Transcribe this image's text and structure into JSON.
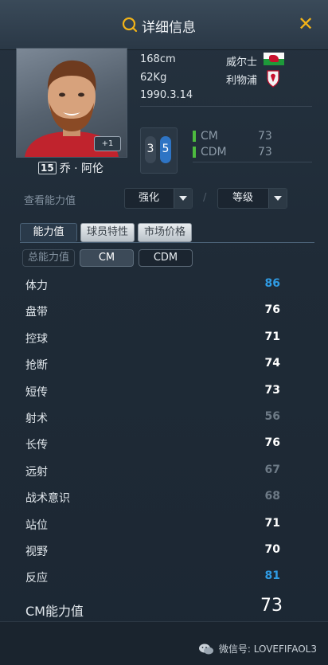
{
  "header": {
    "title": "详细信息"
  },
  "player": {
    "height": "168cm",
    "weight": "62Kg",
    "birthdate": "1990.3.14",
    "nation": "威尔士",
    "club": "利物浦",
    "number": "15",
    "name": "乔 · 阿伦",
    "plus_badge": "+1",
    "left_foot": "3",
    "right_foot": "5",
    "positions": [
      {
        "pos": "CM",
        "rating": "73"
      },
      {
        "pos": "CDM",
        "rating": "73"
      }
    ]
  },
  "view": {
    "label": "查看能力值",
    "enhance_dropdown": "强化",
    "level_dropdown": "等级",
    "slash": "/"
  },
  "tabs": [
    "能力值",
    "球员特性",
    "市场价格"
  ],
  "position_filter": {
    "label": "总能力值",
    "options": [
      "CM",
      "CDM"
    ],
    "selected": "CM"
  },
  "stats": [
    {
      "name": "体力",
      "value": "86",
      "color": "blue"
    },
    {
      "name": "盘带",
      "value": "76",
      "color": "white"
    },
    {
      "name": "控球",
      "value": "71",
      "color": "white"
    },
    {
      "name": "抢断",
      "value": "74",
      "color": "white"
    },
    {
      "name": "短传",
      "value": "73",
      "color": "white"
    },
    {
      "name": "射术",
      "value": "56",
      "color": "grey"
    },
    {
      "name": "长传",
      "value": "76",
      "color": "white"
    },
    {
      "name": "远射",
      "value": "67",
      "color": "grey"
    },
    {
      "name": "战术意识",
      "value": "68",
      "color": "grey"
    },
    {
      "name": "站位",
      "value": "71",
      "color": "white"
    },
    {
      "name": "视野",
      "value": "70",
      "color": "white"
    },
    {
      "name": "反应",
      "value": "81",
      "color": "blue"
    }
  ],
  "overall": {
    "label": "CM能力值",
    "value": "73"
  },
  "footer": {
    "wechat": "微信号: LOVEFIFAOL3"
  },
  "colors": {
    "accent_yellow": "#f2b318",
    "stat_blue": "#2f9be3",
    "stat_grey": "#6d7a86",
    "position_green": "#4dbb3f"
  }
}
